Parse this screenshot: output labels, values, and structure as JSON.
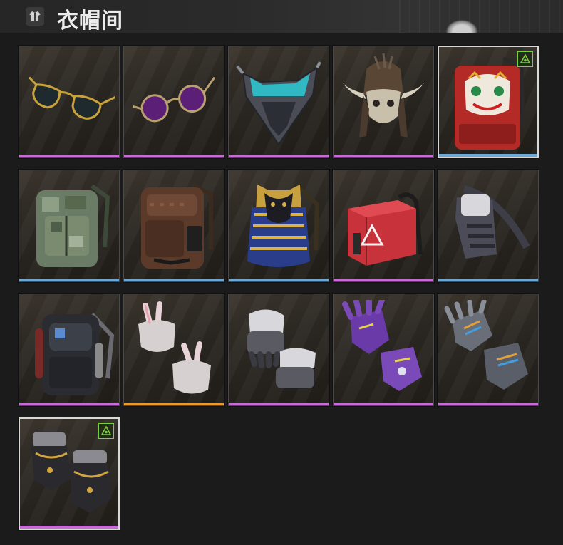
{
  "header": {
    "title": "衣帽间",
    "icon": "wardrobe-icon"
  },
  "colors": {
    "purple": "#c86ad8",
    "blue": "#6aa8d8",
    "orange": "#e89a2c",
    "badge": "#7bcf3c"
  },
  "items": [
    {
      "name": "gold-aviator-sunglasses",
      "icon": "aviator-sunglasses-icon",
      "rarity": "purple",
      "badge": false
    },
    {
      "name": "purple-round-sunglasses",
      "icon": "round-sunglasses-icon",
      "rarity": "purple",
      "badge": false
    },
    {
      "name": "cyber-visor-mask",
      "icon": "visor-mask-icon",
      "rarity": "purple",
      "badge": false
    },
    {
      "name": "horned-skull-helmet",
      "icon": "skull-helmet-icon",
      "rarity": "purple",
      "badge": false
    },
    {
      "name": "lion-dance-backpack",
      "icon": "backpack-icon",
      "rarity": "blue",
      "badge": true
    },
    {
      "name": "digital-camo-backpack",
      "icon": "backpack-icon",
      "rarity": "blue",
      "badge": false
    },
    {
      "name": "brown-pattern-backpack",
      "icon": "backpack-icon",
      "rarity": "blue",
      "badge": false
    },
    {
      "name": "pharaoh-backpack",
      "icon": "backpack-icon",
      "rarity": "blue",
      "badge": false
    },
    {
      "name": "red-box-backpack",
      "icon": "box-backpack-icon",
      "rarity": "purple",
      "badge": false
    },
    {
      "name": "grey-sling-bag",
      "icon": "sling-bag-icon",
      "rarity": "blue",
      "badge": false
    },
    {
      "name": "tactical-black-backpack",
      "icon": "backpack-icon",
      "rarity": "purple",
      "badge": false
    },
    {
      "name": "bunny-gloves",
      "icon": "gloves-icon",
      "rarity": "orange",
      "badge": false
    },
    {
      "name": "fur-trim-gloves",
      "icon": "gloves-icon",
      "rarity": "purple",
      "badge": false
    },
    {
      "name": "purple-graffiti-gloves",
      "icon": "gloves-icon",
      "rarity": "purple",
      "badge": false
    },
    {
      "name": "chrome-rainbow-gloves",
      "icon": "gloves-icon",
      "rarity": "purple",
      "badge": false
    },
    {
      "name": "gold-chain-gauntlets",
      "icon": "gloves-icon",
      "rarity": "purple",
      "badge": true
    }
  ]
}
